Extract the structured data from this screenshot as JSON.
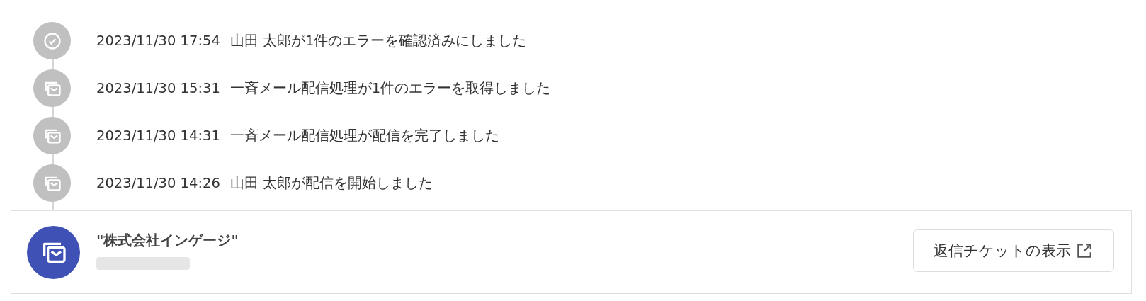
{
  "timeline": [
    {
      "kind": "check",
      "time": "2023/11/30 17:54",
      "message": "山田 太郎が1件のエラーを確認済みにしました"
    },
    {
      "kind": "mail",
      "time": "2023/11/30 15:31",
      "message": "一斉メール配信処理が1件のエラーを取得しました"
    },
    {
      "kind": "mail",
      "time": "2023/11/30 14:31",
      "message": "一斉メール配信処理が配信を完了しました"
    },
    {
      "kind": "mail",
      "time": "2023/11/30 14:26",
      "message": "山田 太郎が配信を開始しました"
    }
  ],
  "card": {
    "title": "\"株式会社インゲージ\"",
    "button": "返信チケットの表示"
  }
}
